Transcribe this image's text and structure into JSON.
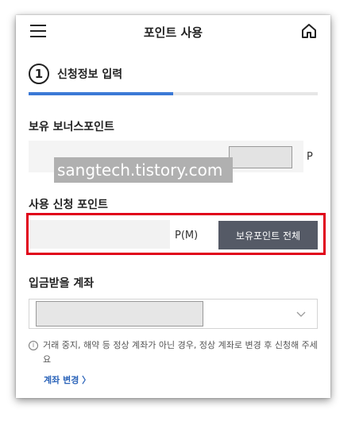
{
  "header": {
    "title": "포인트 사용",
    "menu_icon": "hamburger-menu-icon",
    "home_icon": "home-icon"
  },
  "step": {
    "number": "1",
    "label": "신청정보 입력",
    "progress_fraction": 0.5
  },
  "bonus_points": {
    "label": "보유 보너스포인트",
    "value": "",
    "unit": "P"
  },
  "watermark": "sangtech.tistory.com",
  "apply_points": {
    "label": "사용 신청 포인트",
    "value": "",
    "unit": "P(M)",
    "all_button_label": "보유포인트 전체"
  },
  "account": {
    "label": "입금받을 계좌",
    "selected": "",
    "chevron_icon": "chevron-down-icon"
  },
  "notice": {
    "text": "거래 중지, 해약 등 정상 계좌가 아닌 경우, 정상 계좌로 변경 후 신청해 주세요",
    "change_link": "계좌 변경 〉"
  },
  "colors": {
    "accent": "#3b79d6",
    "highlight": "#e0001a",
    "button": "#555a66",
    "link": "#2a63b9"
  }
}
